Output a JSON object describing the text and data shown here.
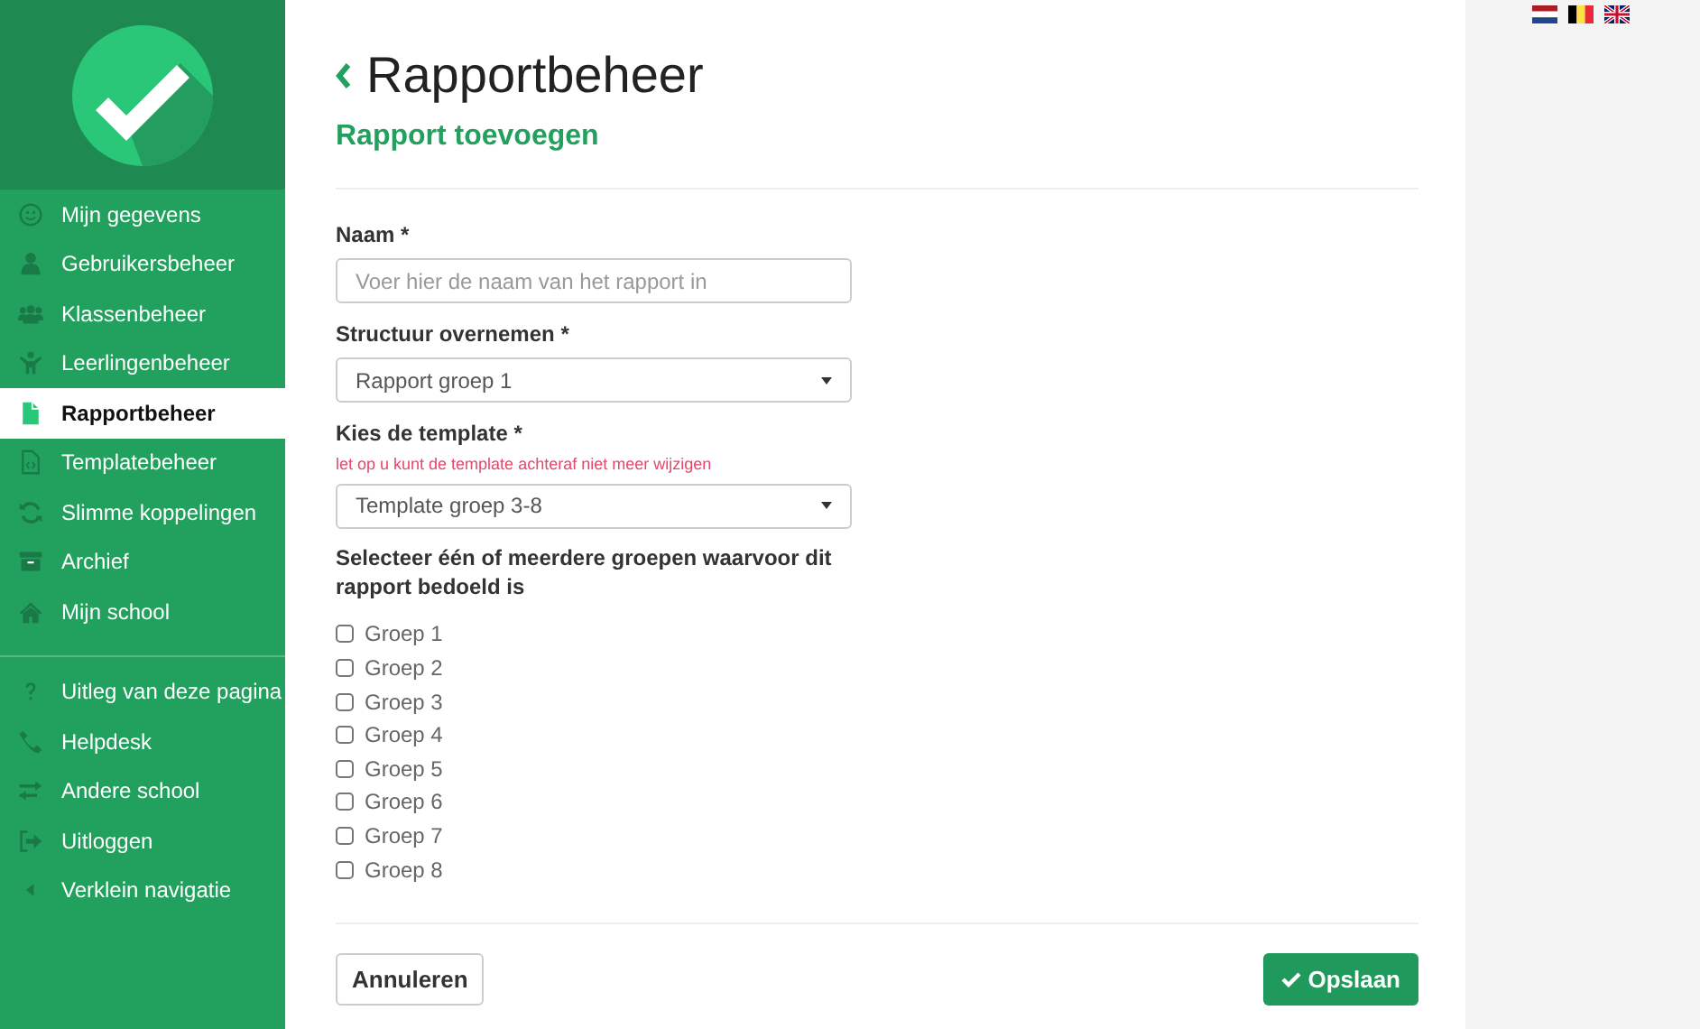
{
  "sidebar": {
    "main_items": [
      {
        "label": "Mijn gegevens",
        "selected": false
      },
      {
        "label": "Gebruikersbeheer",
        "selected": false
      },
      {
        "label": "Klassenbeheer",
        "selected": false
      },
      {
        "label": "Leerlingenbeheer",
        "selected": false
      },
      {
        "label": "Rapportbeheer",
        "selected": true
      },
      {
        "label": "Templatebeheer",
        "selected": false
      },
      {
        "label": "Slimme koppelingen",
        "selected": false
      },
      {
        "label": "Archief",
        "selected": false
      },
      {
        "label": "Mijn school",
        "selected": false
      }
    ],
    "extra_items": [
      {
        "label": "Uitleg van deze pagina",
        "selected": false
      },
      {
        "label": "Helpdesk",
        "selected": false
      },
      {
        "label": "Andere school",
        "selected": false
      },
      {
        "label": "Uitloggen",
        "selected": false
      },
      {
        "label": "Verklein navigatie",
        "selected": false
      }
    ]
  },
  "page": {
    "title": "Rapportbeheer",
    "subtitle": "Rapport toevoegen"
  },
  "form": {
    "fields": [
      {
        "kind": "input",
        "label": "Naam *",
        "placeholder": "Voer hier de naam van het rapport in"
      },
      {
        "kind": "select",
        "label": "Structuur overnemen *",
        "value": "Rapport groep 1"
      },
      {
        "kind": "select",
        "label": "Kies de template *",
        "hint": "let op u kunt de template achteraf niet meer wijzigen",
        "value": "Template groep 3-8"
      }
    ],
    "groups_label": "Selecteer één of meerdere groepen waarvoor dit rapport bedoeld is",
    "groups": [
      {
        "label": "Groep 1",
        "checked": false
      },
      {
        "label": "Groep 2",
        "checked": false
      },
      {
        "label": "Groep 3",
        "checked": false
      },
      {
        "label": "Groep 4",
        "checked": false
      },
      {
        "label": "Groep 5",
        "checked": false
      },
      {
        "label": "Groep 6",
        "checked": false
      },
      {
        "label": "Groep 7",
        "checked": false
      },
      {
        "label": "Groep 8",
        "checked": false
      }
    ]
  },
  "buttons": {
    "cancel": "Annuleren",
    "save": "Opslaan"
  }
}
